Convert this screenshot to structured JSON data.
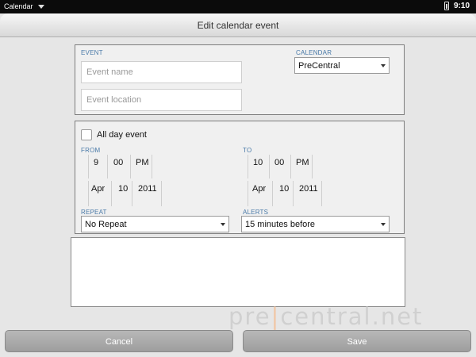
{
  "status_bar": {
    "app_name": "Calendar",
    "time": "9:10"
  },
  "header": {
    "title": "Edit calendar event"
  },
  "event": {
    "section_label": "EVENT",
    "name_placeholder": "Event name",
    "location_placeholder": "Event location"
  },
  "calendar": {
    "section_label": "CALENDAR",
    "selected": "PreCentral"
  },
  "all_day": {
    "label": "All day event",
    "checked": false
  },
  "from": {
    "label": "FROM",
    "hour": "9",
    "minute": "00",
    "ampm": "PM",
    "month": "Apr",
    "day": "10",
    "year": "2011"
  },
  "to": {
    "label": "TO",
    "hour": "10",
    "minute": "00",
    "ampm": "PM",
    "month": "Apr",
    "day": "10",
    "year": "2011"
  },
  "repeat": {
    "section_label": "REPEAT",
    "selected": "No Repeat"
  },
  "alerts": {
    "section_label": "ALERTS",
    "selected": "15 minutes before"
  },
  "buttons": {
    "cancel": "Cancel",
    "save": "Save"
  },
  "watermark": {
    "left": "pre",
    "bar": "|",
    "right": "central.net"
  },
  "colors": {
    "section_label": "#4a7aa8",
    "button": "#a9a9a9",
    "status_bar": "#0b0b0b"
  }
}
